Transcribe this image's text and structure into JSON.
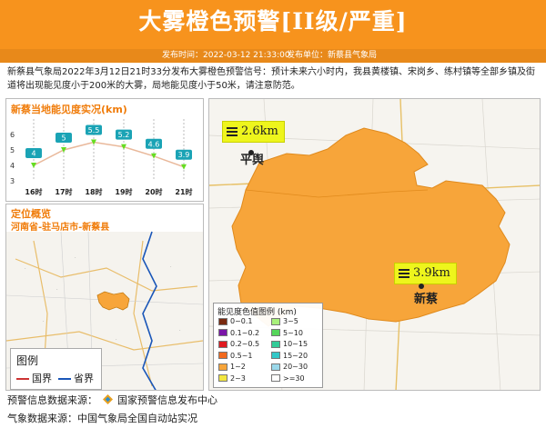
{
  "header": {
    "title": "大雾橙色预警[II级/严重]",
    "publish_time": "发布时间：2022-03-12 21:33:00",
    "publisher": "发布单位：新蔡县气象局"
  },
  "description": "新蔡县气象局2022年3月12日21时33分发布大雾橙色预警信号：预计未来六小时内，我县黄楼镇、宋岗乡、练村镇等全部乡镇及街道将出现能见度小于200米的大雾，局地能见度小于50米，请注意防范。",
  "visibility_panel": {
    "title": "新蔡当地能见度实况(km)",
    "y_ticks": [
      "6",
      "5",
      "4",
      "3"
    ],
    "chart_data": {
      "type": "line",
      "title": "新蔡当地能见度实况(km)",
      "categories": [
        "16时",
        "17时",
        "18时",
        "19时",
        "20时",
        "21时"
      ],
      "values": [
        4,
        5,
        5.5,
        5.2,
        4.6,
        3.9
      ],
      "value_labels": [
        "4",
        "5",
        "5.5",
        "5.2",
        "4.6",
        "3.9"
      ],
      "ylim": [
        3,
        7
      ],
      "colors": {
        "line": "#e9b89a",
        "marker": "#66dd22",
        "label_bg": "#1aa3b5"
      }
    }
  },
  "location_panel": {
    "title": "定位概览",
    "subtitle": "河南省-驻马店市-新蔡县",
    "legend_title": "图例",
    "legend_items": [
      {
        "label": "国界",
        "color": "#c33"
      },
      {
        "label": "省界",
        "color": "#1a56b8"
      }
    ]
  },
  "main_map": {
    "fill_color": "#f7a53a",
    "labels": [
      {
        "name": "平舆",
        "km": "2.6km"
      },
      {
        "name": "新蔡",
        "km": "3.9km"
      }
    ],
    "legend": {
      "title": "能见度色值图例 (km)",
      "items": [
        {
          "label": "0~0.1",
          "color": "#7a2a10"
        },
        {
          "label": "3~5",
          "color": "#a8f07a"
        },
        {
          "label": "0.1~0.2",
          "color": "#7b16a8"
        },
        {
          "label": "5~10",
          "color": "#55d65a"
        },
        {
          "label": "0.2~0.5",
          "color": "#e01a20"
        },
        {
          "label": "10~15",
          "color": "#33cc99"
        },
        {
          "label": "0.5~1",
          "color": "#f36a1e"
        },
        {
          "label": "15~20",
          "color": "#33c8c8"
        },
        {
          "label": "1~2",
          "color": "#f7a53a"
        },
        {
          "label": "20~30",
          "color": "#9ad8ea"
        },
        {
          "label": "2~3",
          "color": "#f2e640"
        },
        {
          "label": ">=30",
          "color": "#ffffff"
        }
      ]
    }
  },
  "footer": {
    "source1_label": "预警信息数据来源：",
    "source1_value": "国家预警信息发布中心",
    "source2": "气象数据来源：中国气象局全国自动站实况"
  }
}
